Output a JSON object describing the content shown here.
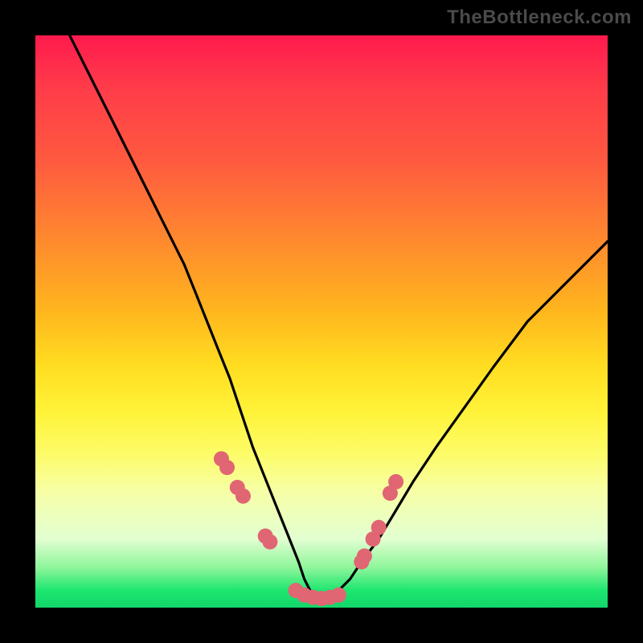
{
  "watermark": "TheBottleneck.com",
  "chart_data": {
    "type": "line",
    "title": "",
    "xlabel": "",
    "ylabel": "",
    "xlim": [
      0,
      100
    ],
    "ylim": [
      0,
      100
    ],
    "series": [
      {
        "name": "bottleneck-curve",
        "x": [
          6,
          10,
          14,
          18,
          22,
          26,
          28,
          30,
          32,
          34,
          36,
          38,
          40,
          42,
          44,
          46,
          47,
          48,
          49,
          50,
          51,
          52,
          53,
          55,
          57,
          60,
          63,
          66,
          70,
          75,
          80,
          86,
          92,
          100
        ],
        "y": [
          100,
          92,
          84,
          76,
          68,
          60,
          55,
          50,
          45,
          40,
          34,
          28,
          23,
          18,
          13,
          8,
          5,
          3,
          2,
          1,
          1,
          2,
          3,
          5,
          8,
          12,
          17,
          22,
          28,
          35,
          42,
          50,
          56,
          64
        ]
      }
    ],
    "markers": {
      "name": "highlight-dots",
      "x": [
        32.5,
        33.5,
        35.3,
        36.3,
        40.2,
        41.0,
        45.5,
        47.0,
        48.5,
        50.0,
        51.5,
        53.0,
        57.0,
        57.5,
        59.0,
        60.0,
        62.0,
        63.0
      ],
      "y": [
        26.0,
        24.5,
        21.0,
        19.5,
        12.5,
        11.5,
        3.0,
        2.2,
        1.8,
        1.6,
        1.8,
        2.2,
        8.0,
        9.0,
        12.0,
        14.0,
        20.0,
        22.0
      ]
    },
    "marker_color": "#e06673",
    "curve_color": "#000000"
  }
}
